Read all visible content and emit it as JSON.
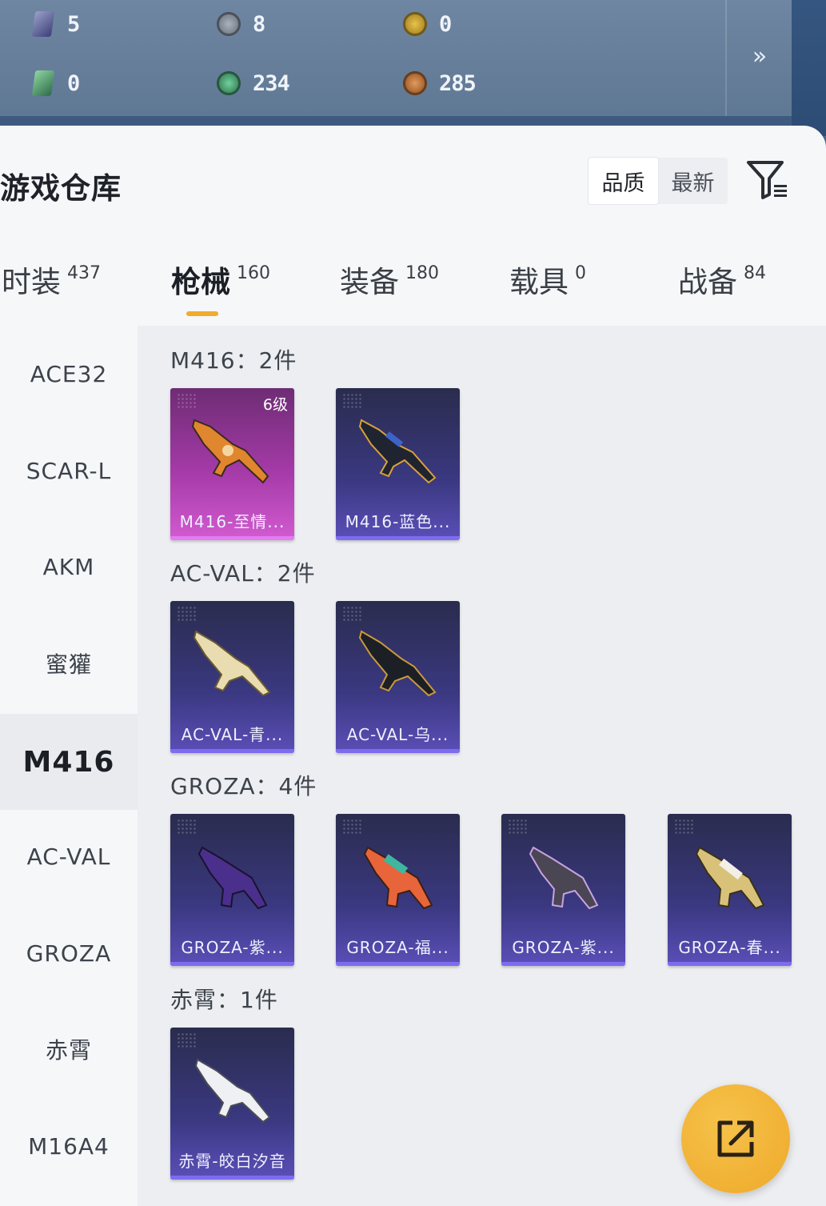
{
  "currencies": [
    {
      "icon": "purple-card-icon",
      "value": "5"
    },
    {
      "icon": "silver-coin-icon",
      "value": "8"
    },
    {
      "icon": "gold-coin-icon",
      "value": "0"
    },
    {
      "icon": "green-card-icon",
      "value": "0"
    },
    {
      "icon": "green-orb-icon",
      "value": "234"
    },
    {
      "icon": "bronze-coin-icon",
      "value": "285"
    }
  ],
  "expand_label": "»",
  "header": {
    "title": "游戏仓库"
  },
  "sort": {
    "options": [
      "品质",
      "最新"
    ],
    "selected": "品质"
  },
  "tabs": [
    {
      "label": "时装",
      "count": "437"
    },
    {
      "label": "枪械",
      "count": "160",
      "active": true
    },
    {
      "label": "装备",
      "count": "180"
    },
    {
      "label": "载具",
      "count": "0"
    },
    {
      "label": "战备",
      "count": "84"
    }
  ],
  "sidebar": {
    "items": [
      "ACE32",
      "SCAR-L",
      "AKM",
      "蜜獾",
      "M416",
      "AC-VAL",
      "GROZA",
      "赤霄",
      "M16A4"
    ],
    "active": "M416"
  },
  "groups": [
    {
      "title": "M416：2件",
      "items": [
        {
          "name": "M416-至情...",
          "level": "6级",
          "rarity": "purple"
        },
        {
          "name": "M416-蓝色...",
          "rarity": "blue"
        }
      ]
    },
    {
      "title": "AC-VAL：2件",
      "items": [
        {
          "name": "AC-VAL-青...",
          "rarity": "blue"
        },
        {
          "name": "AC-VAL-乌...",
          "rarity": "blue"
        }
      ]
    },
    {
      "title": "GROZA：4件",
      "items": [
        {
          "name": "GROZA-紫...",
          "rarity": "blue"
        },
        {
          "name": "GROZA-福...",
          "rarity": "blue"
        },
        {
          "name": "GROZA-紫...",
          "rarity": "blue"
        },
        {
          "name": "GROZA-春...",
          "rarity": "blue"
        }
      ]
    },
    {
      "title": "赤霄：1件",
      "items": [
        {
          "name": "赤霄-皎白汐音",
          "rarity": "blue"
        }
      ]
    }
  ],
  "colors": {
    "accent": "#f0ac2a",
    "card_blue": "#3a3880",
    "card_purple": "#a53aa8"
  }
}
